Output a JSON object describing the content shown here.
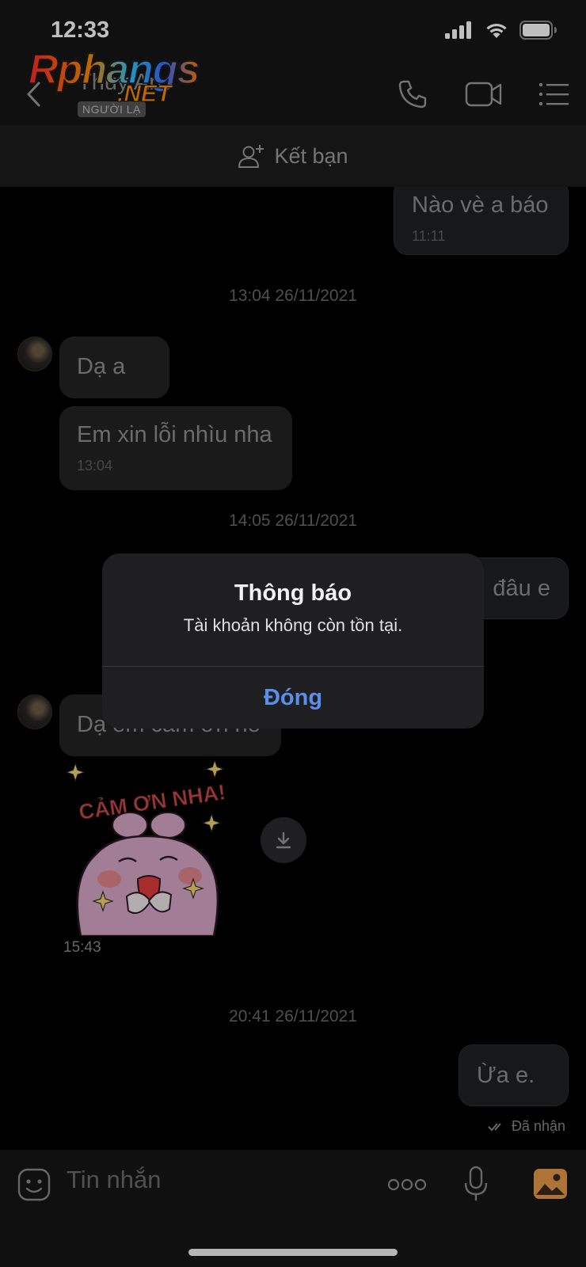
{
  "status_bar": {
    "time": "12:33"
  },
  "header": {
    "contact_name": "Thuy An",
    "stranger_badge": "NGƯỜI LẠ"
  },
  "watermark": {
    "main": "Rphangs",
    "suffix": ".NET"
  },
  "add_friend": {
    "label": "Kết bạn"
  },
  "messages": [
    {
      "side": "out",
      "text": "Nào vè a báo",
      "time": "11:11"
    },
    {
      "side": "in",
      "text": "Dạ a",
      "time": ""
    },
    {
      "side": "in",
      "text": "Em xin lỗi nhìu nha",
      "time": "13:04"
    },
    {
      "side": "out",
      "text": "đâu e",
      "time": ""
    },
    {
      "side": "in",
      "text": "Dạ em cảm ơn nè",
      "time": ""
    },
    {
      "side": "out",
      "text": "Ừa e.",
      "time": ""
    }
  ],
  "date_separators": [
    "13:04 26/11/2021",
    "14:05 26/11/2021",
    "20:41 26/11/2021"
  ],
  "sticker": {
    "caption": "CẢM ƠN NHA!",
    "time": "15:43"
  },
  "status_received": "Đã nhận",
  "dialog": {
    "title": "Thông báo",
    "message": "Tài khoản không còn tồn tại.",
    "button": "Đóng"
  },
  "input": {
    "placeholder": "Tin nhắn"
  },
  "colors": {
    "accent": "#5a8ee8",
    "bubble": "#232325",
    "background": "#000000"
  }
}
